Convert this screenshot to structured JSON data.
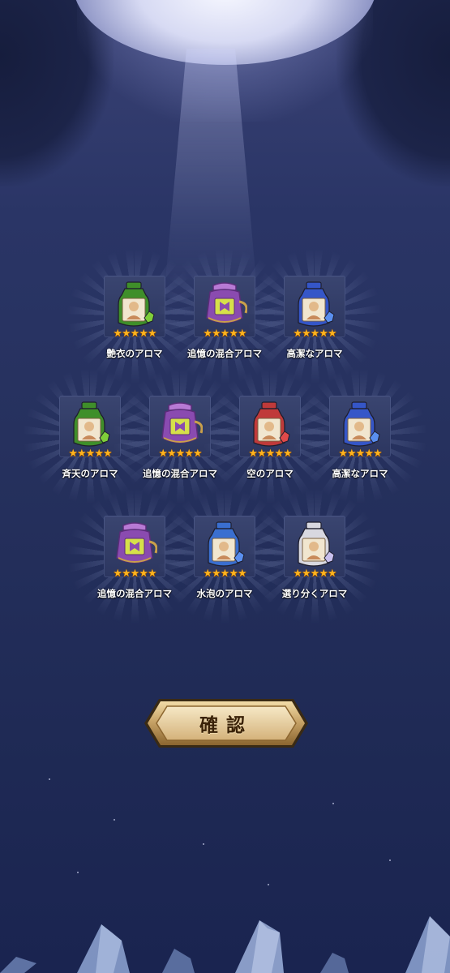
{
  "items": [
    {
      "name": "艶衣のアロマ",
      "rarity": 5,
      "stars": "★★★★★",
      "bottle": "green-bottle",
      "color": "#3f8f2a"
    },
    {
      "name": "追憶の混合アロマ",
      "rarity": 5,
      "stars": "★★★★★",
      "bottle": "purple-kettle",
      "color": "#8a4bb0"
    },
    {
      "name": "高潔なアロマ",
      "rarity": 5,
      "stars": "★★★★★",
      "bottle": "blue-bottle",
      "color": "#3556c8"
    },
    {
      "name": "斉天のアロマ",
      "rarity": 5,
      "stars": "★★★★★",
      "bottle": "green-bottle",
      "color": "#3f8f2a"
    },
    {
      "name": "追憶の混合アロマ",
      "rarity": 5,
      "stars": "★★★★★",
      "bottle": "purple-kettle",
      "color": "#8a4bb0"
    },
    {
      "name": "空のアロマ",
      "rarity": 5,
      "stars": "★★★★★",
      "bottle": "red-bottle",
      "color": "#c03a3a"
    },
    {
      "name": "高潔なアロマ",
      "rarity": 5,
      "stars": "★★★★★",
      "bottle": "blue-bottle",
      "color": "#3556c8"
    },
    {
      "name": "追憶の混合アロマ",
      "rarity": 5,
      "stars": "★★★★★",
      "bottle": "purple-kettle",
      "color": "#8a4bb0"
    },
    {
      "name": "水泡のアロマ",
      "rarity": 5,
      "stars": "★★★★★",
      "bottle": "blue-bottle",
      "color": "#3a6fd0"
    },
    {
      "name": "選り分くアロマ",
      "rarity": 5,
      "stars": "★★★★★",
      "bottle": "white-bottle",
      "color": "#d8d8e0"
    }
  ],
  "confirm_button": {
    "label": "確認"
  },
  "colors": {
    "star": "#ffb41e",
    "button_gold": "#c8a468",
    "background": "#26315e"
  }
}
